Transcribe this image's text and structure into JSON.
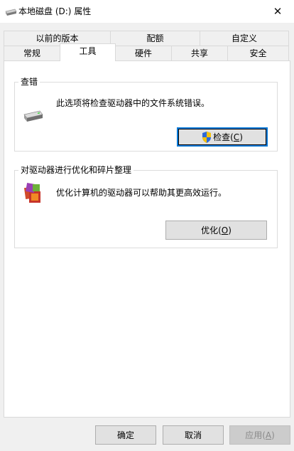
{
  "window": {
    "title": "本地磁盘 (D:) 属性",
    "close_glyph": "✕"
  },
  "tabs_row1": [
    {
      "label": "以前的版本"
    },
    {
      "label": "配额"
    },
    {
      "label": "自定义"
    }
  ],
  "tabs_row2": [
    {
      "label": "常规"
    },
    {
      "label": "工具",
      "active": true
    },
    {
      "label": "硬件"
    },
    {
      "label": "共享"
    },
    {
      "label": "安全"
    }
  ],
  "error_check": {
    "group_label": "查错",
    "description": "此选项将检查驱动器中的文件系统错误。",
    "button_text": "检查(",
    "button_accel": "C",
    "button_close": ")",
    "button_icon": "uac-shield-icon"
  },
  "optimize": {
    "group_label": "对驱动器进行优化和碎片整理",
    "description": "优化计算机的驱动器可以帮助其更高效运行。",
    "button_text": "优化(",
    "button_accel": "O",
    "button_close": ")"
  },
  "footer": {
    "ok_label": "确定",
    "cancel_label": "取消",
    "apply_text": "应用(",
    "apply_accel": "A",
    "apply_close": ")"
  },
  "colors": {
    "focus_border": "#0078d7",
    "window_bg": "#f0f0f0",
    "panel_bg": "#ffffff"
  }
}
